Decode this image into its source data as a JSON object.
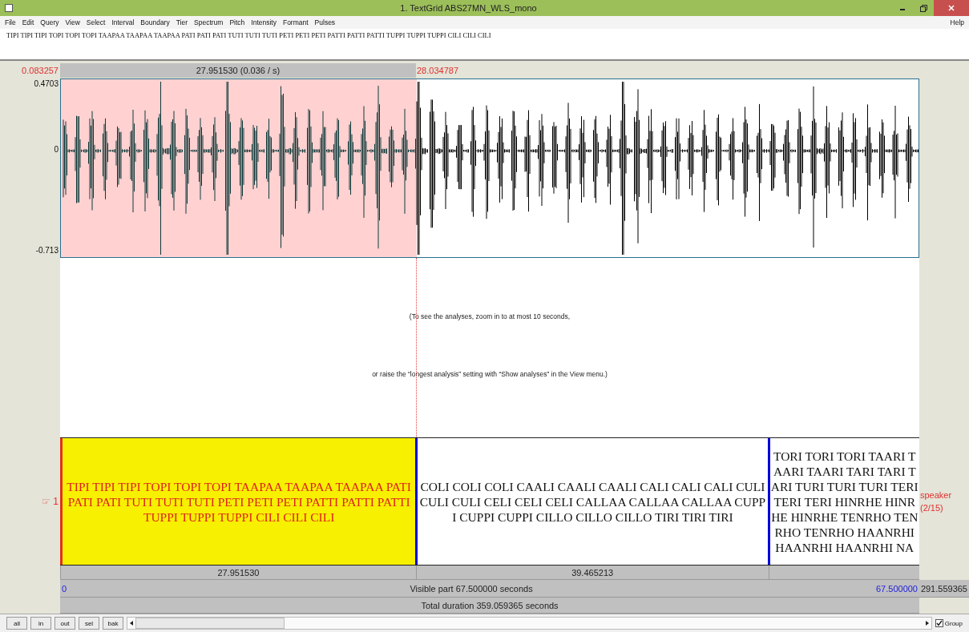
{
  "window": {
    "title": "1. TextGrid ABS27MN_WLS_mono"
  },
  "menu": [
    "File",
    "Edit",
    "Query",
    "View",
    "Select",
    "Interval",
    "Boundary",
    "Tier",
    "Spectrum",
    "Pitch",
    "Intensity",
    "Formant",
    "Pulses"
  ],
  "help_menu": "Help",
  "text_field": {
    "value": "TIPI TIPI TIPI TOPI TOPI TOPI TAAPAA TAAPAA TAAPAA PATI PATI PATI TUTI TUTI TUTI PETI PETI PETI PATTI PATTI PATTI TUPPI TUPPI TUPPI CILI CILI CILI"
  },
  "time_ruler": {
    "start": "0.083257",
    "selection": "27.951530 (0.036 / s)",
    "end": "28.034787"
  },
  "sound": {
    "y_max": "0.4703",
    "y_zero": "0",
    "y_min": "-0.713"
  },
  "analysis_message": [
    "(To see the analyses, zoom in to at most 10 seconds,",
    "or raise the “longest analysis” setting with “Show analyses” in the View menu.)"
  ],
  "tier": {
    "pointer": "☞",
    "number": "1",
    "name": "speaker",
    "count": "(2/15)",
    "intervals": [
      {
        "text": "TIPI TIPI TIPI TOPI TOPI TOPI TAAPAA TAAPAA TAAPAA PATI\nPATI PATI TUTI TUTI TUTI PETI PETI PETI PATTI PATTI PATTI\nTUPPI TUPPI TUPPI CILI CILI CILI",
        "selected": true,
        "duration": "27.951530"
      },
      {
        "text": "COLI COLI COLI CAALI CAALI CAALI CALI CALI CALI CULI\nCULI CULI CELI CELI CELI CALLAA CALLAA CALLAA CUPP\nI CUPPI CUPPI CILLO CILLO CILLO TIRI TIRI TIRI",
        "selected": false,
        "duration": "39.465213"
      },
      {
        "text": "TORI TORI TORI TAARI T\nAARI TAARI TARI TARI T\nARI TURI TURI TURI TERI\nTERI TERI HINRHE HINR\nHE HINRHE TENRHO TEN\nRHO TENRHO HAANRHI\nHAANRHI HAANRHI NA",
        "selected": false
      }
    ]
  },
  "visible": {
    "start": "0",
    "label": "Visible part 67.500000 seconds",
    "end": "67.500000",
    "after": "291.559365"
  },
  "total": "Total duration 359.059365 seconds",
  "buttons": [
    "all",
    "in",
    "out",
    "sel",
    "bak"
  ],
  "group": {
    "label": "Group",
    "checked": true
  }
}
